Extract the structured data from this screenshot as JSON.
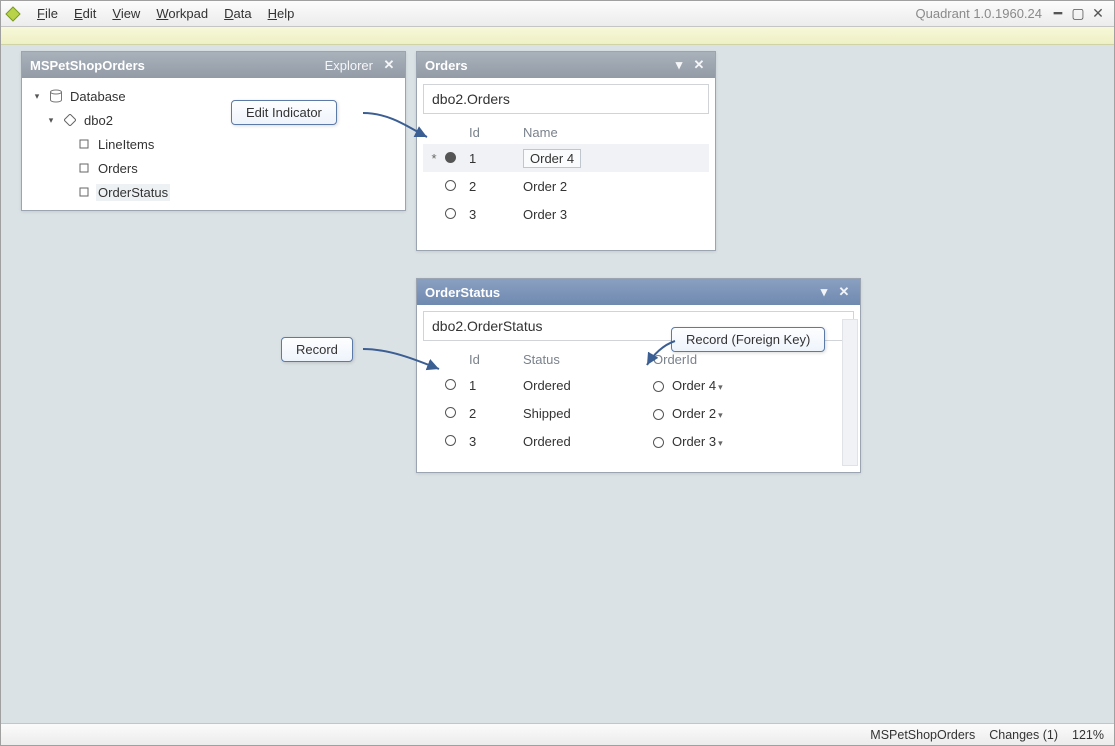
{
  "app": {
    "title": "Quadrant 1.0.1960.24"
  },
  "menu": {
    "file": "File",
    "edit": "Edit",
    "view": "View",
    "workpad": "Workpad",
    "data": "Data",
    "help": "Help"
  },
  "explorer": {
    "title": "MSPetShopOrders",
    "subtitle": "Explorer",
    "root": "Database",
    "schema": "dbo2",
    "tables": {
      "lineitems": "LineItems",
      "orders": "Orders",
      "orderstatus": "OrderStatus"
    }
  },
  "orders_panel": {
    "title": "Orders",
    "breadcrumb": "dbo2.Orders",
    "columns": {
      "id": "Id",
      "name": "Name"
    },
    "rows": [
      {
        "edit": true,
        "id": "1",
        "name": "Order 4"
      },
      {
        "edit": false,
        "id": "2",
        "name": "Order 2"
      },
      {
        "edit": false,
        "id": "3",
        "name": "Order 3"
      }
    ]
  },
  "orderstatus_panel": {
    "title": "OrderStatus",
    "breadcrumb": "dbo2.OrderStatus",
    "columns": {
      "id": "Id",
      "status": "Status",
      "order": "OrderId"
    },
    "rows": [
      {
        "id": "1",
        "status": "Ordered",
        "order": "Order 4"
      },
      {
        "id": "2",
        "status": "Shipped",
        "order": "Order 2"
      },
      {
        "id": "3",
        "status": "Ordered",
        "order": "Order 3"
      }
    ]
  },
  "callouts": {
    "edit_indicator": "Edit Indicator",
    "record": "Record",
    "record_fk": "Record (Foreign Key)"
  },
  "status": {
    "project": "MSPetShopOrders",
    "changes": "Changes (1)",
    "zoom": "121%"
  }
}
